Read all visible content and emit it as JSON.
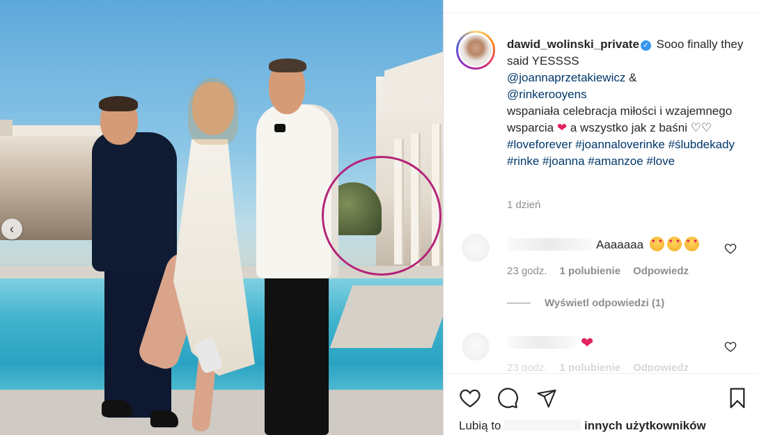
{
  "post": {
    "username": "dawid_wolinski_private",
    "caption_intro": "Sooo finally they said YESSSS",
    "mentions": [
      "@joannaprzetakiewicz",
      "@rinkerooyens"
    ],
    "mention_joiner": "&",
    "caption_body_1": "wspaniała celebracja miłości i wzajemnego wsparcia",
    "caption_body_2": "a wszystko jak z baśni",
    "hashtags": [
      "#loveforever",
      "#joannaloverinke",
      "#ślubdekady",
      "#rinke",
      "#joanna",
      "#amanzoe",
      "#love"
    ],
    "time_ago": "1 dzień"
  },
  "comments": [
    {
      "text": "Aaaaaaa",
      "time": "23 godz.",
      "likes": "1 polubienie",
      "reply": "Odpowiedz"
    },
    {
      "text": "",
      "time": "23 godz.",
      "likes": "1 polubienie",
      "reply": "Odpowiedz"
    }
  ],
  "view_replies": "Wyświetl odpowiedzi (1)",
  "likes_line": {
    "prefix": "Lubią to",
    "suffix": "innych użytkowników"
  },
  "icons": {
    "verified": "verified-badge-icon",
    "like": "heart-outline-icon",
    "comment": "speech-bubble-icon",
    "share": "paper-plane-icon",
    "save": "bookmark-icon",
    "prev": "chevron-left-icon"
  },
  "colors": {
    "link": "#00376b",
    "highlight_ring": "#b5237a",
    "verified": "#3897f0",
    "heart": "#e0245e"
  }
}
